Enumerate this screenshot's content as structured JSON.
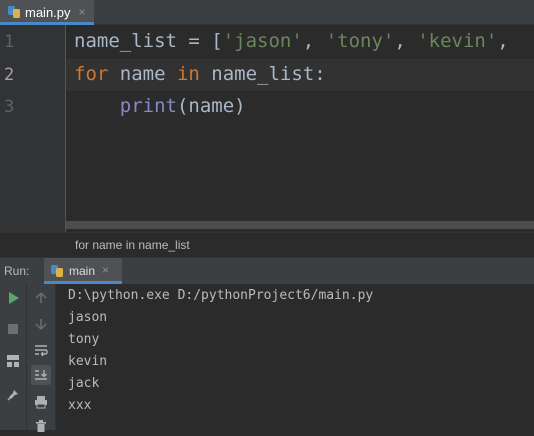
{
  "editor": {
    "tab": {
      "filename": "main.py",
      "close": "×"
    },
    "line_numbers": [
      "1",
      "2",
      "3"
    ],
    "code": {
      "line1": {
        "var": "name_list",
        "op": " = [",
        "s1": "'jason'",
        "c1": ", ",
        "s2": "'tony'",
        "c2": ", ",
        "s3": "'kevin'",
        "c3": ","
      },
      "line2": {
        "kw1": "for",
        "t1": " name ",
        "kw2": "in",
        "t2": " name_list:"
      },
      "line3": {
        "indent": "    ",
        "fn": "print",
        "args": "(name)"
      }
    },
    "breadcrumb": "for name in name_list"
  },
  "run": {
    "label": "Run:",
    "tab_label": "main",
    "tab_close": "×",
    "console_lines": [
      "D:\\python.exe D:/pythonProject6/main.py",
      "jason",
      "tony",
      "kevin",
      "jack",
      "xxx"
    ]
  },
  "colors": {
    "background": "#2b2b2b",
    "keyword": "#cc7832",
    "string": "#6a8759",
    "builtin": "#8888c6",
    "text": "#a9b7c6",
    "accent": "#4a88c7"
  },
  "icons": [
    "python-file-icon",
    "run-icon",
    "stop-icon",
    "layout-icon",
    "pin-icon",
    "up-arrow-icon",
    "down-arrow-icon",
    "soft-wrap-icon",
    "scroll-to-end-icon",
    "print-icon",
    "trash-icon"
  ]
}
